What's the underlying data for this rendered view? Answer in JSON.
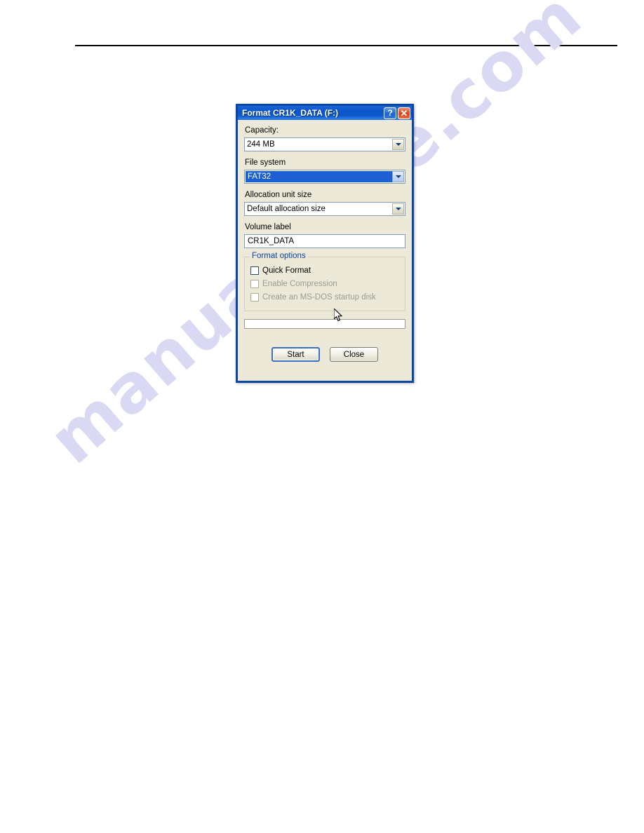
{
  "page": {
    "watermark": "manualshive.com",
    "watermark_color": "#d9d9f4",
    "rule_color": "#000000",
    "background_color": "#ffffff"
  },
  "dialog": {
    "title": "Format CR1K_DATA (F:)",
    "accent_color": "#0a46a5",
    "face_color": "#ece9d8",
    "titlebar_buttons": [
      {
        "name": "help",
        "glyph": "?"
      },
      {
        "name": "close",
        "glyph": "✕"
      }
    ],
    "fields": {
      "capacity": {
        "label": "Capacity:",
        "value": "244 MB"
      },
      "file_system": {
        "label": "File system",
        "value": "FAT32",
        "selected_highlight": "#1d5fd0"
      },
      "allocation_unit_size": {
        "label": "Allocation unit size",
        "value": "Default allocation size"
      },
      "volume_label": {
        "label": "Volume label",
        "value": "CR1K_DATA"
      }
    },
    "format_options": {
      "legend": "Format options",
      "legend_color": "#0d3f9e",
      "checkboxes": [
        {
          "label": "Quick Format",
          "checked": false,
          "enabled": true
        },
        {
          "label": "Enable Compression",
          "checked": false,
          "enabled": false
        },
        {
          "label": "Create an MS-DOS startup disk",
          "checked": false,
          "enabled": false
        }
      ]
    },
    "progress": {
      "value": 0
    },
    "buttons": [
      {
        "label": "Start",
        "default": true
      },
      {
        "label": "Close",
        "default": false
      }
    ]
  }
}
